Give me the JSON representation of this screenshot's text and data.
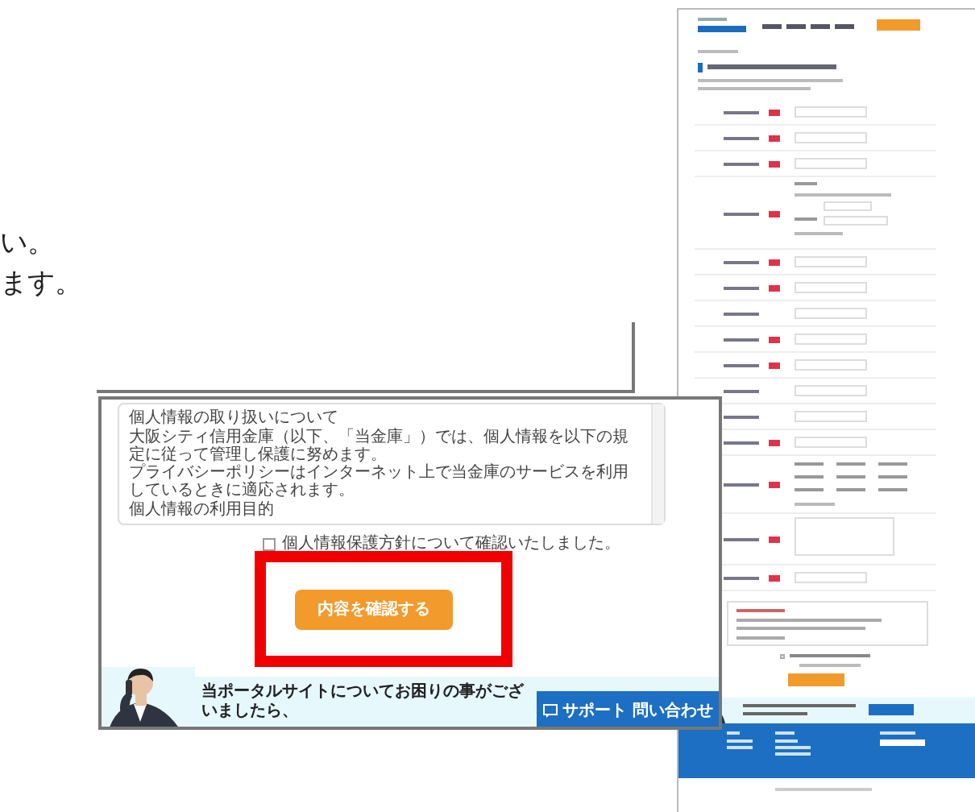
{
  "intro_text": [
    "い。",
    "ます。"
  ],
  "zoomed_page": {
    "policy_text": [
      {
        "kind": "heading",
        "text": "個人情報の取り扱いについて"
      },
      {
        "kind": "paragraph",
        "text": "大阪シティ信用金庫（以下、「当金庫」）では、個人情報を以下の規定に従って管理し保護に努めます。"
      },
      {
        "kind": "paragraph",
        "text": "プライバシーポリシーはインターネット上で当金庫のサービスを利用しているときに適応されます。"
      },
      {
        "kind": "heading",
        "text": "個人情報の利用目的"
      }
    ],
    "consent": {
      "label": "個人情報保護方針について確認いたしました。",
      "checked": false
    },
    "confirm_button": "内容を確認する",
    "highlighted": true,
    "banner": {
      "message": "当ポータルサイトについてお困りの事がございましたら、",
      "button": "サポート 問い合わせ"
    }
  },
  "thumbnail_page": {
    "form_rows": [
      {
        "kind": "short",
        "required": true
      },
      {
        "kind": "short",
        "required": true
      },
      {
        "kind": "short",
        "required": true
      },
      {
        "kind": "tall",
        "required": true
      },
      {
        "kind": "short",
        "required": true
      },
      {
        "kind": "short",
        "required": true
      },
      {
        "kind": "short",
        "required": false
      },
      {
        "kind": "short",
        "required": true
      },
      {
        "kind": "short",
        "required": true
      },
      {
        "kind": "short",
        "required": false
      },
      {
        "kind": "short",
        "required": false
      },
      {
        "kind": "short",
        "required": true
      },
      {
        "kind": "options",
        "required": true
      },
      {
        "kind": "textarea",
        "required": true
      },
      {
        "kind": "short",
        "required": true
      }
    ],
    "consent_checked": false
  }
}
